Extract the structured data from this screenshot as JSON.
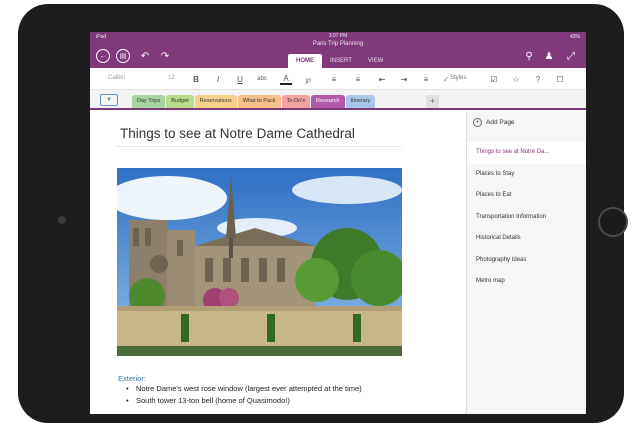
{
  "status_bar": {
    "carrier": "iPad",
    "time": "3:07 PM",
    "battery": "43%"
  },
  "titlebar": {
    "doc_title": "Paris Trip Planning",
    "icons": [
      "back-icon",
      "notebooks-icon",
      "undo-icon",
      "redo-icon",
      "search-icon",
      "share-icon",
      "fullscreen-icon"
    ]
  },
  "ribbon": {
    "tabs": [
      {
        "label": "HOME",
        "active": true
      },
      {
        "label": "INSERT",
        "active": false
      },
      {
        "label": "VIEW",
        "active": false
      }
    ]
  },
  "toolbar": {
    "font_name": "Calibri",
    "font_size": "12",
    "styles_label": "Styles",
    "tools": [
      "bold-icon",
      "italic-icon",
      "underline-icon",
      "strikethrough-icon",
      "font-color-icon",
      "clear-format-icon",
      "bullets-icon",
      "numbering-icon",
      "outdent-icon",
      "indent-icon",
      "align-icon",
      "styles-icon",
      "checkbox-icon",
      "star-icon",
      "question-icon",
      "tag-icon"
    ]
  },
  "sections": [
    {
      "label": "Day Trips",
      "color": "#a8d4a2",
      "active": false
    },
    {
      "label": "Budget",
      "color": "#b9dc8a",
      "active": false
    },
    {
      "label": "Reservations",
      "color": "#f6d18c",
      "active": false
    },
    {
      "label": "What to Pack",
      "color": "#f6c08a",
      "active": false
    },
    {
      "label": "To-Do's",
      "color": "#f3a3a0",
      "active": false
    },
    {
      "label": "Research",
      "color": "#b05aa8",
      "active": true
    },
    {
      "label": "Itinerary",
      "color": "#a9c7ea",
      "active": false
    }
  ],
  "page": {
    "title": "Things to see at Notre Dame Cathedral",
    "image_alt": "Notre Dame Cathedral photo",
    "exterior_heading": "Exterior:",
    "bullets": [
      "Notre Dame's west rose window (largest ever attempted at the time)",
      "South tower 13-ton bell (home of Quasimodo!)"
    ]
  },
  "pages_pane": {
    "add_page_label": "Add Page",
    "pages": [
      {
        "label": "Things to see at Notre Da...",
        "active": true
      },
      {
        "label": "Places to Stay",
        "active": false
      },
      {
        "label": "Places to Eat",
        "active": false
      },
      {
        "label": "Transportation Information",
        "active": false
      },
      {
        "label": "Historical Details",
        "active": false
      },
      {
        "label": "Photography Ideas",
        "active": false
      },
      {
        "label": "Metro map",
        "active": false
      }
    ]
  },
  "colors": {
    "accent": "#80397b",
    "heading_blue": "#2e75b6"
  }
}
